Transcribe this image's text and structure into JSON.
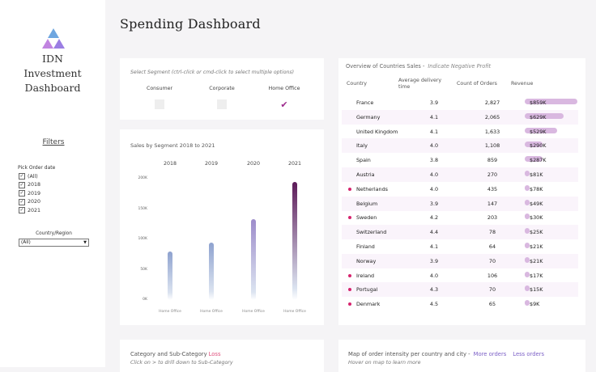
{
  "sidebar": {
    "logo_lines": [
      "IDN",
      "Investment",
      "Dashboard"
    ],
    "filters_heading": "Filters",
    "order_date": {
      "label": "Pick Order date",
      "options": [
        {
          "label": "(All)",
          "checked": true
        },
        {
          "label": "2018",
          "checked": true
        },
        {
          "label": "2019",
          "checked": true
        },
        {
          "label": "2020",
          "checked": true
        },
        {
          "label": "2021",
          "checked": true
        }
      ]
    },
    "country_region": {
      "label": "Country/Region",
      "value": "(All)"
    }
  },
  "page_title": "Spending Dashboard",
  "segment_card": {
    "hint": "Select Segment (ctrl-click or cmd-click to select multiple options)",
    "options": [
      {
        "label": "Consumer",
        "selected": false
      },
      {
        "label": "Corporate",
        "selected": false
      },
      {
        "label": "Home Office",
        "selected": true
      }
    ]
  },
  "sales_chart": {
    "title": "Sales by Segment 2018 to 2021",
    "chart_data": {
      "type": "bar",
      "categories": [
        "2018",
        "2019",
        "2020",
        "2021"
      ],
      "series": [
        {
          "name": "Home Office",
          "values": [
            80000,
            95000,
            133000,
            195000
          ]
        }
      ],
      "category_axis_labels": [
        "Home Office",
        "Home Office",
        "Home Office",
        "Home Office"
      ],
      "yticks": [
        "0K",
        "50K",
        "100K",
        "150K",
        "200K"
      ],
      "ylim": [
        0,
        200000
      ],
      "grid": false,
      "colors": {
        "low": "#dbe3f0",
        "mid": "#9d8ccb",
        "high": "#5c1a58"
      }
    }
  },
  "countries": {
    "title": "Overview of Countries Sales -",
    "note": "Indicate Negative Profit",
    "columns": [
      "Country",
      "Average delivery time",
      "Count of Orders",
      "Revenue"
    ],
    "max_revenue": 859,
    "rows": [
      {
        "country": "France",
        "delivery": "3.9",
        "orders": "2,827",
        "revenue": "$859K",
        "revenue_k": 859,
        "negative_profit": false
      },
      {
        "country": "Germany",
        "delivery": "4.1",
        "orders": "2,065",
        "revenue": "$629K",
        "revenue_k": 629,
        "negative_profit": false
      },
      {
        "country": "United Kingdom",
        "delivery": "4.1",
        "orders": "1,633",
        "revenue": "$529K",
        "revenue_k": 529,
        "negative_profit": false
      },
      {
        "country": "Italy",
        "delivery": "4.0",
        "orders": "1,108",
        "revenue": "$290K",
        "revenue_k": 290,
        "negative_profit": false
      },
      {
        "country": "Spain",
        "delivery": "3.8",
        "orders": "859",
        "revenue": "$287K",
        "revenue_k": 287,
        "negative_profit": false
      },
      {
        "country": "Austria",
        "delivery": "4.0",
        "orders": "270",
        "revenue": "$81K",
        "revenue_k": 81,
        "negative_profit": false
      },
      {
        "country": "Netherlands",
        "delivery": "4.0",
        "orders": "435",
        "revenue": "$78K",
        "revenue_k": 78,
        "negative_profit": true
      },
      {
        "country": "Belgium",
        "delivery": "3.9",
        "orders": "147",
        "revenue": "$49K",
        "revenue_k": 49,
        "negative_profit": false
      },
      {
        "country": "Sweden",
        "delivery": "4.2",
        "orders": "203",
        "revenue": "$30K",
        "revenue_k": 30,
        "negative_profit": true
      },
      {
        "country": "Switzerland",
        "delivery": "4.4",
        "orders": "78",
        "revenue": "$25K",
        "revenue_k": 25,
        "negative_profit": false
      },
      {
        "country": "Finland",
        "delivery": "4.1",
        "orders": "64",
        "revenue": "$21K",
        "revenue_k": 21,
        "negative_profit": false
      },
      {
        "country": "Norway",
        "delivery": "3.9",
        "orders": "70",
        "revenue": "$21K",
        "revenue_k": 21,
        "negative_profit": false
      },
      {
        "country": "Ireland",
        "delivery": "4.0",
        "orders": "106",
        "revenue": "$17K",
        "revenue_k": 17,
        "negative_profit": true
      },
      {
        "country": "Portugal",
        "delivery": "4.3",
        "orders": "70",
        "revenue": "$15K",
        "revenue_k": 15,
        "negative_profit": true
      },
      {
        "country": "Denmark",
        "delivery": "4.5",
        "orders": "65",
        "revenue": "$9K",
        "revenue_k": 9,
        "negative_profit": true
      }
    ]
  },
  "category_card": {
    "title": "Category and Sub-Category",
    "loss": "Loss",
    "hint": "Click on > to drill down to Sub-Category"
  },
  "map_card": {
    "title": "Map of order intensity per country and city -",
    "more_orders": "More orders",
    "less_orders": "Less orders",
    "hint": "Hover on map to learn more"
  },
  "colors": {
    "accent": "#9c2a8c",
    "negative_dot": "#d6246e",
    "revenue_bar": "#d9b8e0",
    "loss": "#e0507d",
    "link": "#7b5fc6"
  }
}
